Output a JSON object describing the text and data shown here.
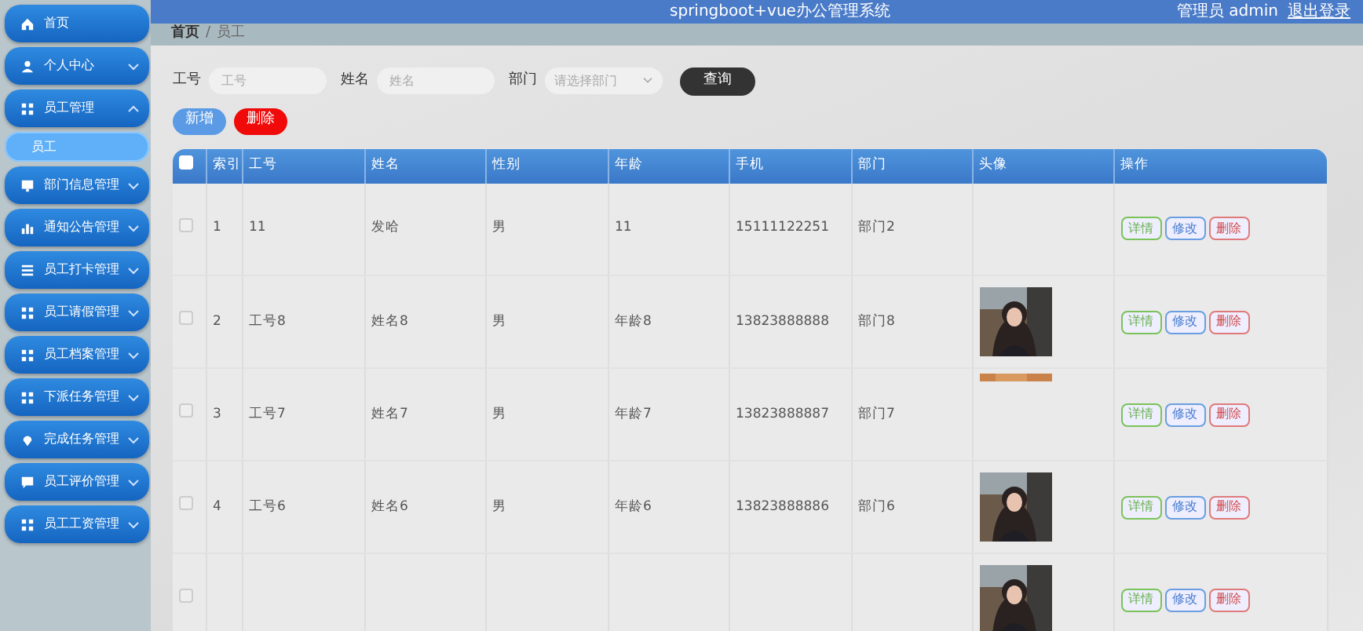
{
  "sidebar": {
    "items": [
      {
        "label": "首页",
        "selected": false
      },
      {
        "label": "个人中心",
        "selected": false,
        "expanded": false
      },
      {
        "label": "员工管理",
        "selected": false,
        "expanded": true,
        "children": [
          {
            "label": "员工",
            "selected": true
          }
        ]
      },
      {
        "label": "部门信息管理",
        "selected": false,
        "expanded": false
      },
      {
        "label": "通知公告管理",
        "selected": false,
        "expanded": false
      },
      {
        "label": "员工打卡管理",
        "selected": false,
        "expanded": false
      },
      {
        "label": "员工请假管理",
        "selected": false,
        "expanded": false
      },
      {
        "label": "员工档案管理",
        "selected": false,
        "expanded": false
      },
      {
        "label": "下派任务管理",
        "selected": false,
        "expanded": false
      },
      {
        "label": "完成任务管理",
        "selected": false,
        "expanded": false
      },
      {
        "label": "员工评价管理",
        "selected": false,
        "expanded": false
      },
      {
        "label": "员工工资管理",
        "selected": false,
        "expanded": false
      }
    ]
  },
  "header": {
    "title": "springboot+vue办公管理系统",
    "user": "管理员 admin",
    "logout": "退出登录"
  },
  "breadcrumb": {
    "items": [
      "首页",
      "员工"
    ],
    "separator": "/"
  },
  "filters": [
    {
      "label": "工号",
      "placeholder": "工号",
      "kind": "text"
    },
    {
      "label": "姓名",
      "placeholder": "姓名",
      "kind": "text"
    },
    {
      "label": "部门",
      "placeholder": "请选择部门",
      "kind": "select"
    }
  ],
  "search_button": "查询",
  "add_button": "新增",
  "delete_button": "删除",
  "table": {
    "select_all": {
      "checked": false
    },
    "columns": [
      "索引",
      "工号",
      "姓名",
      "性别",
      "年龄",
      "手机",
      "部门",
      "头像",
      "操作"
    ],
    "rows": [
      {
        "checked": false,
        "cells": [
          "1",
          "11",
          "发哈",
          "男",
          "11",
          "15111122251",
          "部门2"
        ],
        "actions": [
          "详情",
          "修改",
          "删除"
        ]
      },
      {
        "checked": false,
        "cells": [
          "2",
          "工号8",
          "姓名8",
          "男",
          "年龄8",
          "13823888888",
          "部门8"
        ],
        "avatar": {
          "kind": "picture",
          "loaded": true
        },
        "actions": [
          "详情",
          "修改",
          "删除"
        ]
      },
      {
        "checked": false,
        "cells": [
          "3",
          "工号7",
          "姓名7",
          "男",
          "年龄7",
          "13823888887",
          "部门7"
        ],
        "avatar": {
          "kind": "picture",
          "loaded": false
        },
        "actions": [
          "详情",
          "修改",
          "删除"
        ]
      },
      {
        "checked": false,
        "cells": [
          "4",
          "工号6",
          "姓名6",
          "男",
          "年龄6",
          "13823888886",
          "部门6"
        ],
        "avatar": {
          "kind": "picture",
          "loaded": true
        },
        "actions": [
          "详情",
          "修改",
          "删除"
        ]
      },
      {
        "checked": false,
        "cells": [],
        "avatar": {
          "kind": "picture",
          "loaded": true
        },
        "actions": [
          "详情",
          "修改",
          "删除"
        ]
      }
    ]
  }
}
